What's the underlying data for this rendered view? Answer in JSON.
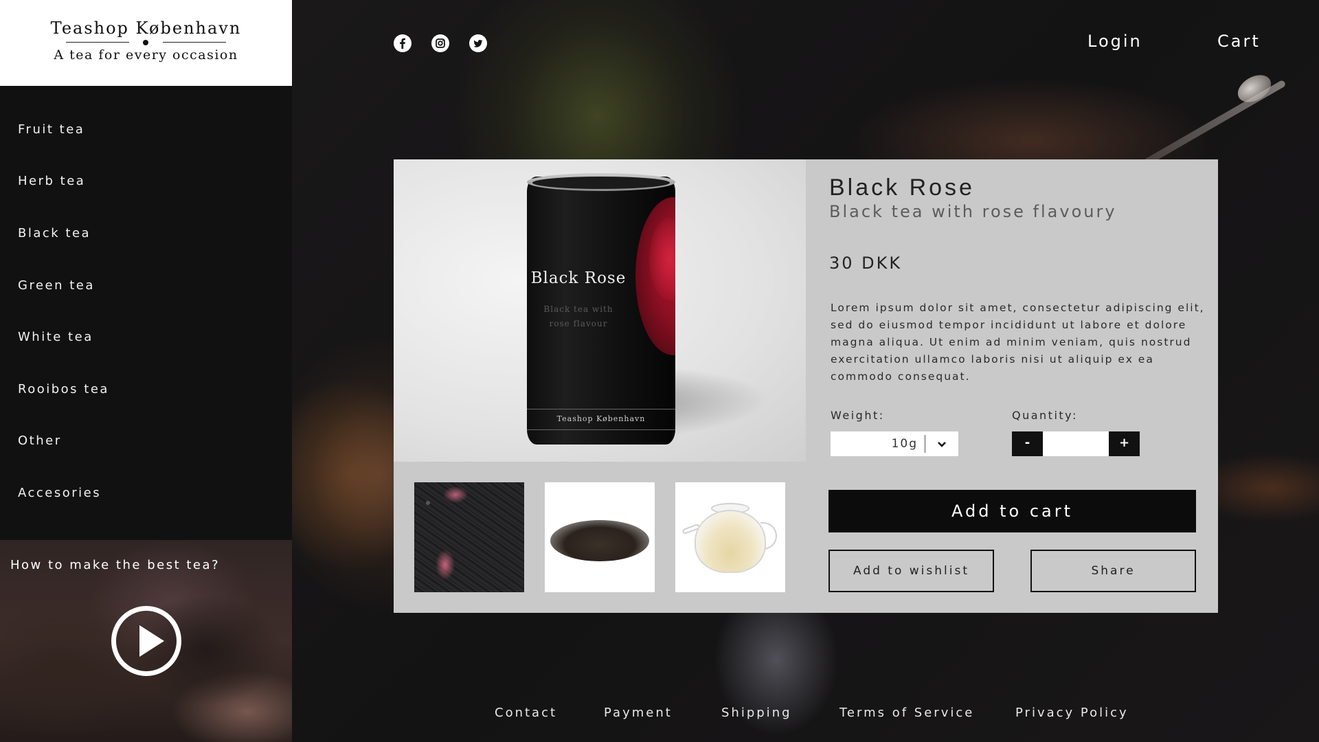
{
  "brand": {
    "name": "Teashop København",
    "tagline": "A tea for every occasion"
  },
  "sidebar": {
    "items": [
      {
        "label": "Fruit tea"
      },
      {
        "label": "Herb tea"
      },
      {
        "label": "Black tea"
      },
      {
        "label": "Green tea"
      },
      {
        "label": "White tea"
      },
      {
        "label": "Rooibos tea"
      },
      {
        "label": "Other"
      },
      {
        "label": "Accesories"
      }
    ],
    "video_title": "How to make the best tea?"
  },
  "header": {
    "social": [
      "facebook-icon",
      "instagram-icon",
      "twitter-icon"
    ],
    "login_label": "Login",
    "cart_label": "Cart"
  },
  "product": {
    "name": "Black Rose",
    "subtitle": "Black tea with rose flavoury",
    "price": "30 DKK",
    "description": "Lorem ipsum dolor sit amet, consectetur adipiscing elit, sed do eiusmod tempor incididunt ut labore et dolore magna aliqua. Ut enim ad minim veniam, quis nostrud exercitation ullamco laboris nisi ut aliquip ex ea commodo consequat.",
    "package": {
      "title": "Black Rose",
      "subtitle_line1": "Black tea with",
      "subtitle_line2": "rose flavour",
      "brand": "Teashop København"
    },
    "weight_label": "Weight:",
    "weight_value": "10g",
    "quantity_label": "Quantity:",
    "quantity_value": "",
    "minus_label": "-",
    "plus_label": "+",
    "add_to_cart_label": "Add to cart",
    "add_to_wishlist_label": "Add to wishlist",
    "share_label": "Share"
  },
  "footer": {
    "links": [
      "Contact",
      "Payment",
      "Shipping",
      "Terms of Service",
      "Privacy Policy"
    ]
  },
  "colors": {
    "background": "#161516",
    "sidebar": "#111111",
    "card": "#c9c9c9",
    "primary_button": "#0c0c0c",
    "rose_accent": "#a3122a"
  }
}
